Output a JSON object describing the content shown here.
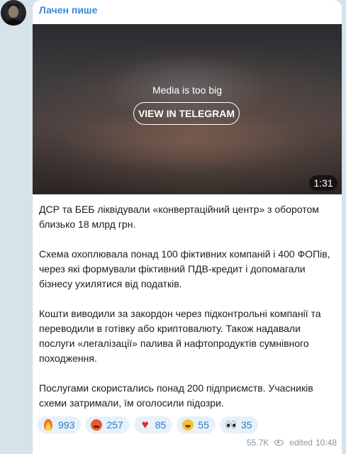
{
  "channel": {
    "name": "Лачен пише"
  },
  "media": {
    "notice": "Media is too big",
    "button_label": "VIEW IN TELEGRAM",
    "duration": "1:31"
  },
  "message": {
    "paragraphs": [
      "ДСР та БЕБ ліквідували «конвертаційний центр» з оборотом близько 18 млрд грн.",
      "Схема охоплювала понад 100 фіктивних компаній і 400 ФОПів, через які формували фіктивний ПДВ-кредит і допомагали бізнесу ухилятися від податків.",
      "Кошти виводили за закордон через підконтрольні компанії та переводили в готівку або криптовалюту. Також надавали послуги «легалізації» палива й нафтопродуктів сумнівного походження.",
      "Послугами скористались понад 200 підприємств. Учасників схеми затримали, їм оголосили підозри."
    ]
  },
  "reactions": [
    {
      "icon": "fire-emoji-icon",
      "count": "993"
    },
    {
      "icon": "angry-face-emoji-icon",
      "count": "257"
    },
    {
      "icon": "heart-emoji-icon",
      "count": "85"
    },
    {
      "icon": "smile-emoji-icon",
      "count": "55"
    },
    {
      "icon": "eyes-emoji-icon",
      "count": "35"
    }
  ],
  "meta": {
    "views": "55.7K",
    "edited_label": "edited",
    "time": "10:48"
  },
  "colors": {
    "accent": "#3a8ad8",
    "background": "#d7e3ea",
    "reaction_bg": "#e7f1fa"
  }
}
